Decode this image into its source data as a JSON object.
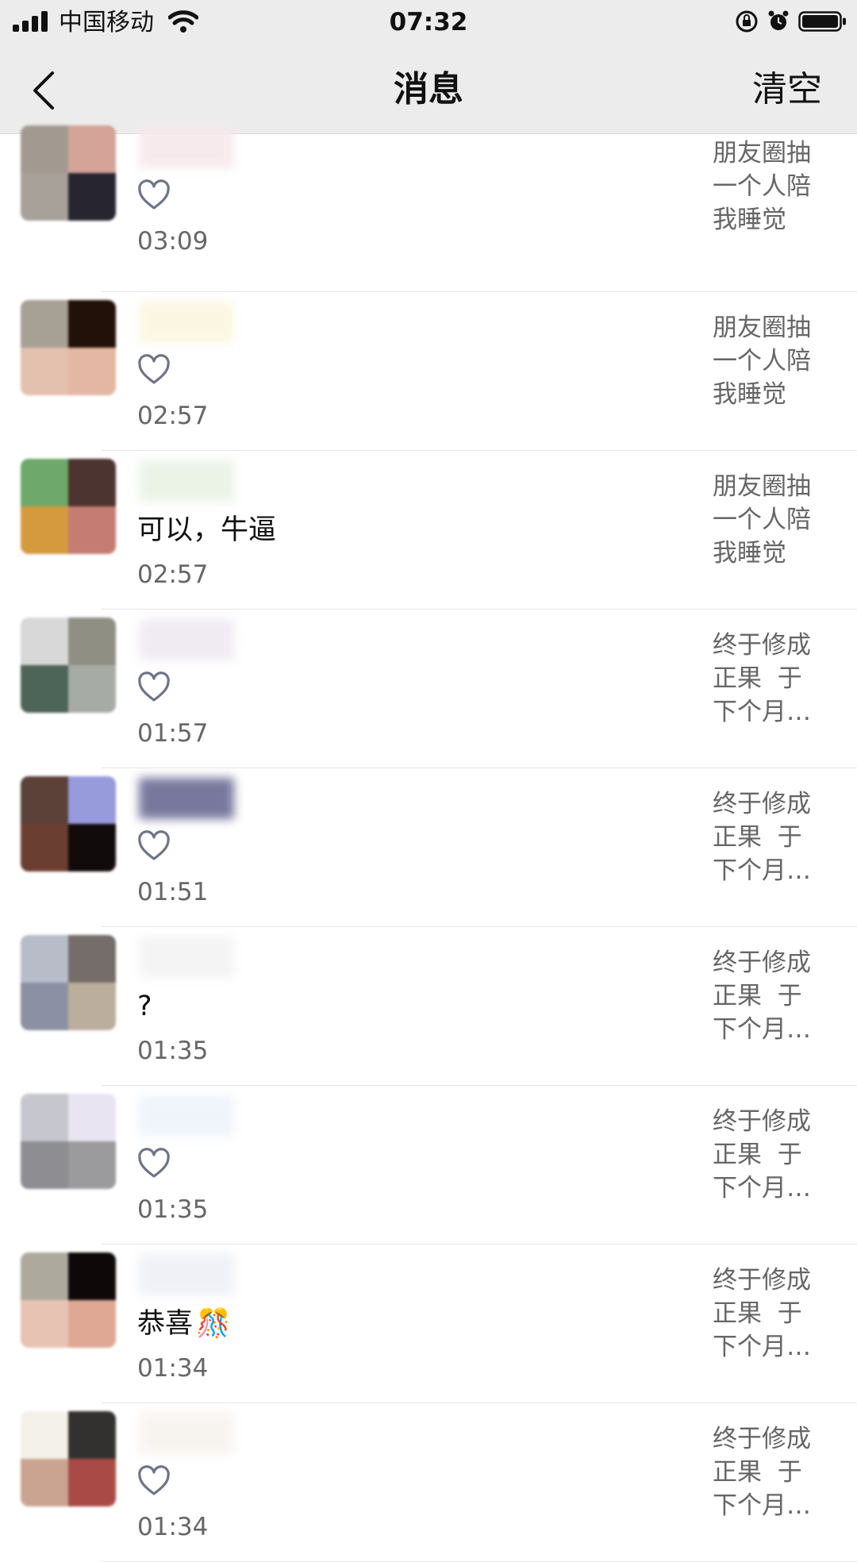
{
  "status_bar": {
    "carrier": "中国移动",
    "time": "07:32",
    "signal_icon": "signal-bars-icon",
    "wifi_icon": "wifi-icon",
    "lock_icon": "rotation-lock-icon",
    "alarm_icon": "alarm-icon",
    "battery_icon": "battery-icon"
  },
  "nav": {
    "back_icon": "chevron-left-icon",
    "title": "消息",
    "clear_label": "清空"
  },
  "messages": [
    {
      "type": "like",
      "text": "",
      "time": "03:09",
      "preview": [
        "朋友圈抽",
        "一个人陪",
        "我睡觉"
      ],
      "avatar": [
        "#a29a90",
        "#d3a497",
        "#a8a19a",
        "#272630"
      ],
      "name_color": "#f7e8ec"
    },
    {
      "type": "like",
      "text": "",
      "time": "02:57",
      "preview": [
        "朋友圈抽",
        "一个人陪",
        "我睡觉"
      ],
      "avatar": [
        "#a6a095",
        "#221109",
        "#e4c0ae",
        "#e3b7a3"
      ],
      "name_color": "#fbf6df"
    },
    {
      "type": "comment",
      "text": "可以，牛逼",
      "time": "02:57",
      "preview": [
        "朋友圈抽",
        "一个人陪",
        "我睡觉"
      ],
      "avatar": [
        "#6ea86a",
        "#4c3430",
        "#d5993e",
        "#c47c73"
      ],
      "name_color": "#e9f1e4"
    },
    {
      "type": "like",
      "text": "",
      "time": "01:57",
      "preview": [
        "终于修成",
        "正果  于",
        "下个月…"
      ],
      "avatar": [
        "#d8d8d8",
        "#8f8f83",
        "#4d6458",
        "#a7aba5"
      ],
      "name_color": "#efe9f2"
    },
    {
      "type": "like",
      "text": "",
      "time": "01:51",
      "preview": [
        "终于修成",
        "正果  于",
        "下个月…"
      ],
      "avatar": [
        "#5b4138",
        "#979bdc",
        "#6a3e30",
        "#120b0c"
      ],
      "name_color": "#6a6a94"
    },
    {
      "type": "comment",
      "text": "?",
      "time": "01:35",
      "preview": [
        "终于修成",
        "正果  于",
        "下个月…"
      ],
      "avatar": [
        "#b8bcc8",
        "#746d69",
        "#8c90a4",
        "#bcae9d"
      ],
      "name_color": "#f3f3f3"
    },
    {
      "type": "like",
      "text": "",
      "time": "01:35",
      "preview": [
        "终于修成",
        "正果  于",
        "下个月…"
      ],
      "avatar": [
        "#c5c6ce",
        "#e8e4f2",
        "#8e8e92",
        "#9b9b9d"
      ],
      "name_color": "#eef3fb"
    },
    {
      "type": "comment",
      "text": "恭喜",
      "emoji": "🎊",
      "time": "01:34",
      "preview": [
        "终于修成",
        "正果  于",
        "下个月…"
      ],
      "avatar": [
        "#aea99d",
        "#0e0808",
        "#e6c3b2",
        "#dfa895"
      ],
      "name_color": "#eef0f6"
    },
    {
      "type": "like",
      "text": "",
      "time": "01:34",
      "preview": [
        "终于修成",
        "正果  于",
        "下个月…"
      ],
      "avatar": [
        "#f4f1ea",
        "#323130",
        "#caa491",
        "#a94a47"
      ],
      "name_color": "#f7f3ef"
    }
  ]
}
